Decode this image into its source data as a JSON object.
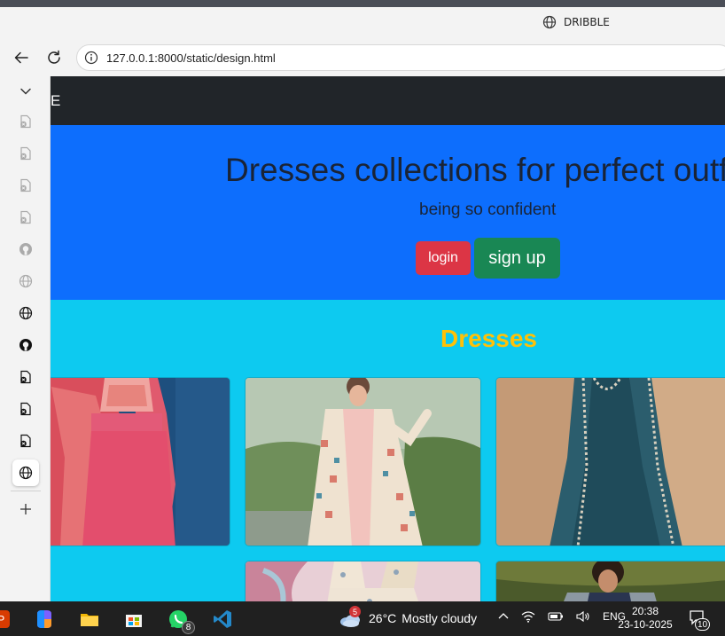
{
  "window": {
    "title": "DRIBBLE"
  },
  "browser": {
    "url": "127.0.0.1:8000/static/design.html"
  },
  "page": {
    "brand": "E",
    "hero": {
      "title": "Dresses collections for perfect outfit",
      "subtitle": "being so confident",
      "login_label": "login",
      "signup_label": "sign up"
    },
    "section_title": "Dresses"
  },
  "taskbar": {
    "whatsapp_badge": "8",
    "weather_badge": "5",
    "temperature": "26°C",
    "weather_text": "Mostly cloudy",
    "language": "ENG",
    "time": "20:38",
    "date": "23-10-2025",
    "notification_count": "10"
  },
  "colors": {
    "navbar": "#212529",
    "hero": "#0d6efd",
    "section": "#0dcaf0",
    "login": "#dc3545",
    "signup": "#198754",
    "section_title": "#ffc107"
  },
  "icons": {
    "sidebar": [
      "collapse-chevron-icon",
      "tab-favicon-icon",
      "tab-favicon-icon",
      "tab-favicon-icon",
      "tab-favicon-icon",
      "github-icon",
      "globe-icon",
      "globe-icon",
      "github-icon",
      "tab-favicon-icon",
      "tab-favicon-icon",
      "tab-favicon-icon",
      "globe-icon",
      "new-tab-plus-icon"
    ]
  }
}
